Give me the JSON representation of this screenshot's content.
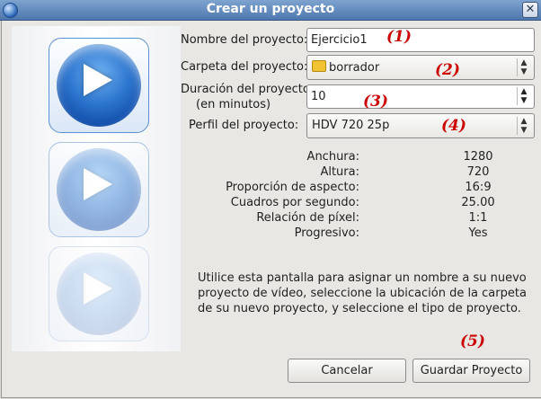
{
  "window": {
    "title": "Crear un proyecto"
  },
  "form": {
    "name_label": "Nombre del proyecto:",
    "name_value": "Ejercicio1",
    "folder_label": "Carpeta del proyecto:",
    "folder_value": "borrador",
    "duration_label_1": "Duración del proyecto",
    "duration_label_2": "(en minutos)",
    "duration_value": "10",
    "profile_label": "Perfil del proyecto:",
    "profile_value": "HDV 720 25p"
  },
  "annotations": [
    "(1)",
    "(2)",
    "(3)",
    "(4)",
    "(5)"
  ],
  "profile_info": [
    {
      "key": "Anchura:",
      "value": "1280"
    },
    {
      "key": "Altura:",
      "value": "720"
    },
    {
      "key": "Proporción de aspecto:",
      "value": "16:9"
    },
    {
      "key": "Cuadros por segundo:",
      "value": "25.00"
    },
    {
      "key": "Relación de píxel:",
      "value": "1:1"
    },
    {
      "key": "Progresivo:",
      "value": "Yes"
    }
  ],
  "help_text": "Utilice esta pantalla para asignar un nombre a su nuevo proyecto de vídeo, seleccione la ubicación de la carpeta de su nuevo proyecto, y seleccione el tipo de proyecto.",
  "buttons": {
    "cancel": "Cancelar",
    "save": "Guardar Proyecto"
  },
  "icons": {
    "app": "app-icon",
    "close": "close-icon",
    "folder": "folder-icon",
    "play": "play-icon"
  }
}
